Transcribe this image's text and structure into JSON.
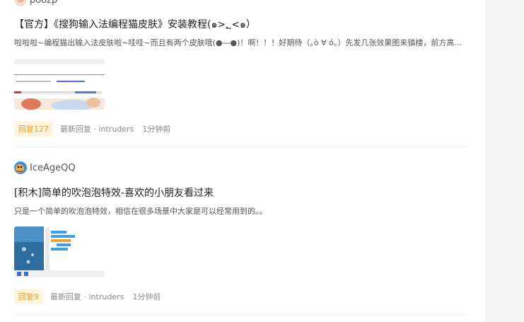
{
  "posts": [
    {
      "author": "poozp",
      "title": "【官方】《搜狗输入法编程猫皮肤》安装教程(๑>؂<๑）",
      "excerpt": "啦啦啦~编程猫出输入法皮肤啦~哇哇~而且有两个皮肤哦(●—●)！啊！！！好期待（｡ò ∀ ó｡）先发几张效果图来镇楼，前方高...",
      "replies": "回复127",
      "latest_reply": "最新回复 · intruders",
      "time": "1分钟前"
    },
    {
      "author": "IceAgeQQ",
      "title": "[积木]简单的吹泡泡特效-喜欢的小朋友看过来",
      "excerpt": "只是一个简单的吹泡泡特效，相信在很多场景中大家是可以经常用到的。。",
      "replies": "回复9",
      "latest_reply": "最新回复 · intruders",
      "time": "1分钟前"
    }
  ],
  "colors": {
    "reply_badge_bg": "#fff4dd",
    "reply_badge_text": "#f0a020",
    "rail": "#f4f4f4"
  }
}
